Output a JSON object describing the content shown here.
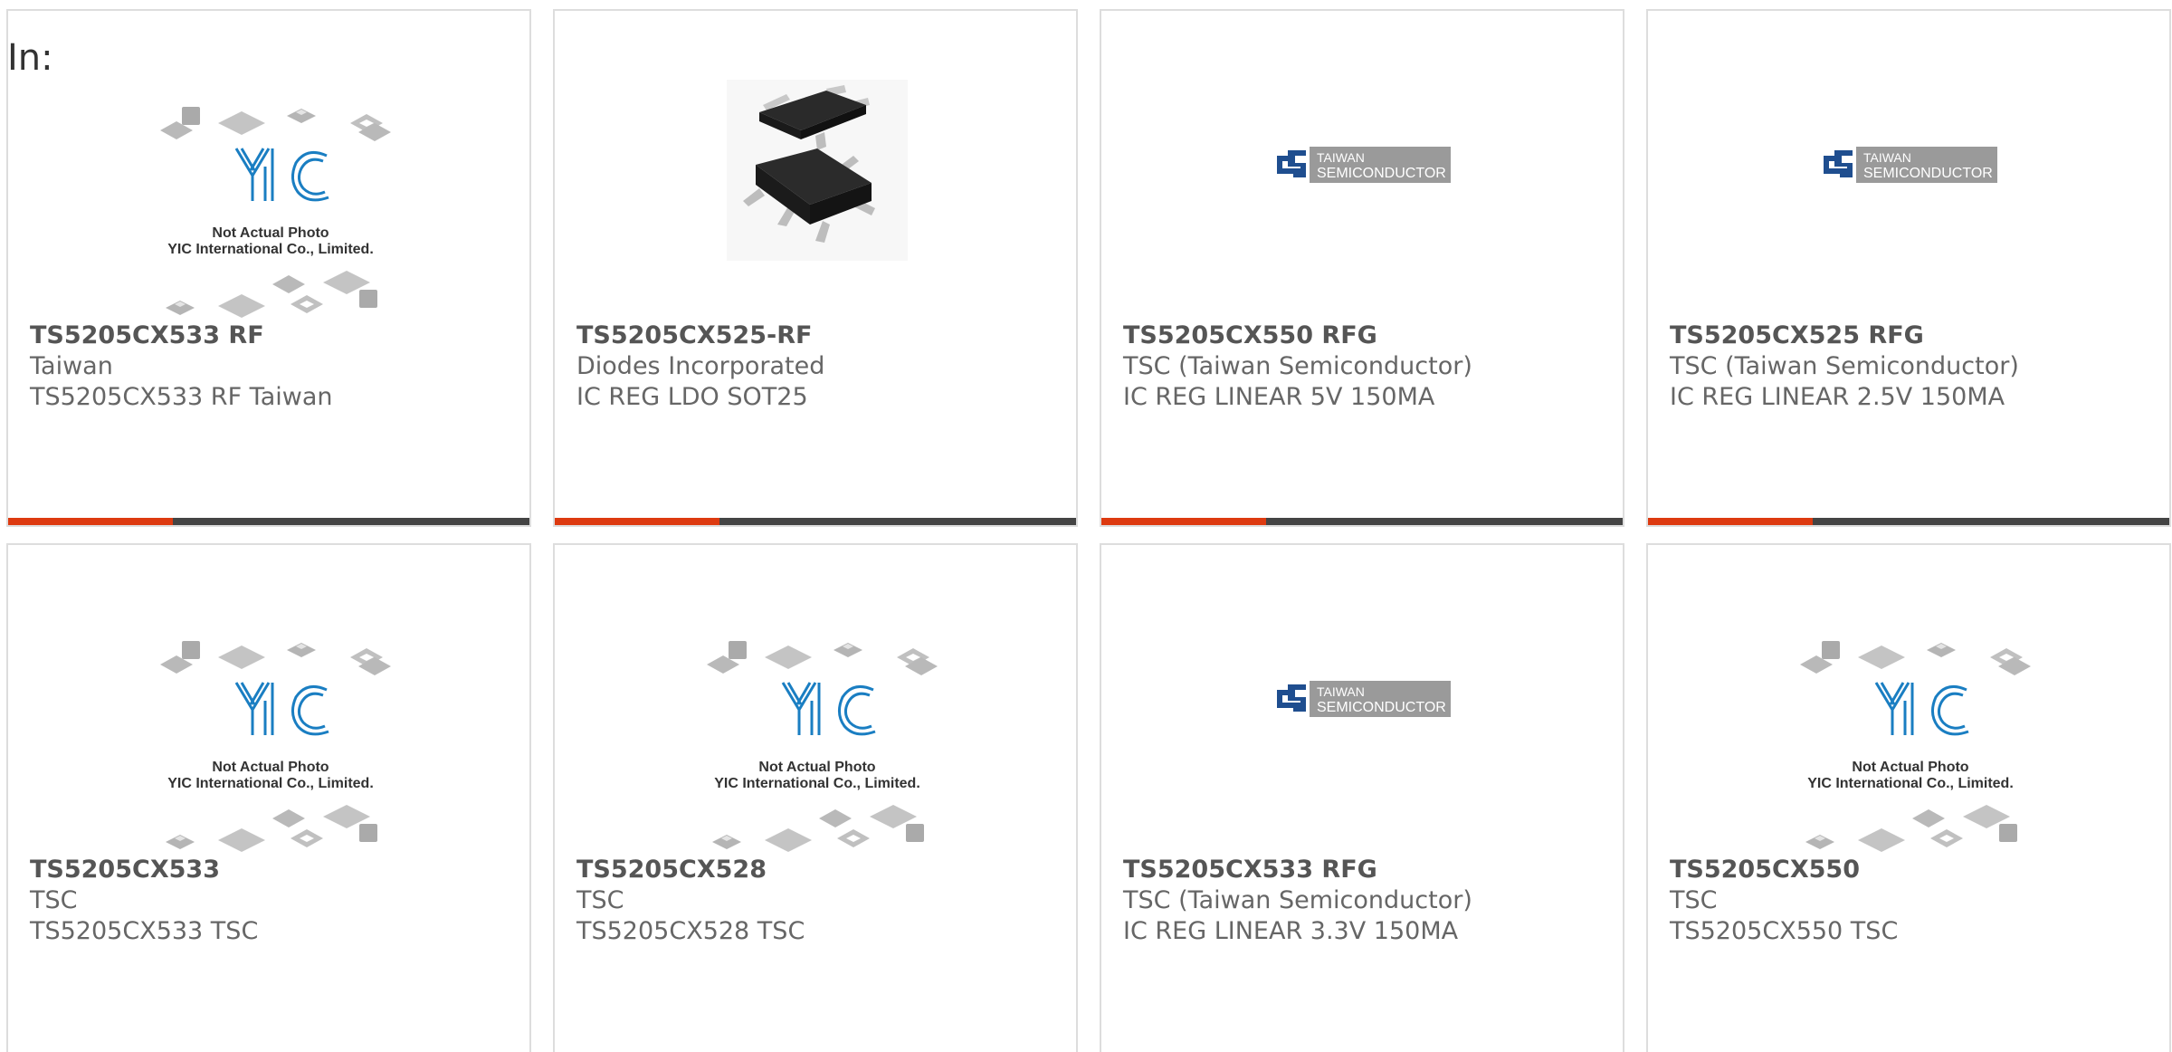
{
  "filter_label": "In:",
  "accent_color": "#dd3a10",
  "bar_color": "#444444",
  "products": [
    {
      "part": "TS5205CX533 RF",
      "maker": "Taiwan",
      "desc": "TS5205CX533 RF Taiwan",
      "image": "yic-placeholder",
      "image_caption_1": "Not Actual Photo",
      "image_caption_2": "YIC International Co., Limited."
    },
    {
      "part": "TS5205CX525-RF",
      "maker": "Diodes Incorporated",
      "desc": "IC REG LDO SOT25",
      "image": "sot25-chip"
    },
    {
      "part": "TS5205CX550 RFG",
      "maker": "TSC (Taiwan Semiconductor)",
      "desc": "IC REG LINEAR 5V 150MA",
      "image": "taiwan-semiconductor-logo",
      "logo_text_1": "TAIWAN",
      "logo_text_2": "SEMICONDUCTOR"
    },
    {
      "part": "TS5205CX525 RFG",
      "maker": "TSC (Taiwan Semiconductor)",
      "desc": "IC REG LINEAR 2.5V 150MA",
      "image": "taiwan-semiconductor-logo",
      "logo_text_1": "TAIWAN",
      "logo_text_2": "SEMICONDUCTOR"
    },
    {
      "part": "TS5205CX533",
      "maker": "TSC",
      "desc": "TS5205CX533 TSC",
      "image": "yic-placeholder",
      "image_caption_1": "Not Actual Photo",
      "image_caption_2": "YIC International Co., Limited."
    },
    {
      "part": "TS5205CX528",
      "maker": "TSC",
      "desc": "TS5205CX528 TSC",
      "image": "yic-placeholder",
      "image_caption_1": "Not Actual Photo",
      "image_caption_2": "YIC International Co., Limited."
    },
    {
      "part": "TS5205CX533 RFG",
      "maker": "TSC (Taiwan Semiconductor)",
      "desc": "IC REG LINEAR 3.3V 150MA",
      "image": "taiwan-semiconductor-logo",
      "logo_text_1": "TAIWAN",
      "logo_text_2": "SEMICONDUCTOR"
    },
    {
      "part": "TS5205CX550",
      "maker": "TSC",
      "desc": "TS5205CX550 TSC",
      "image": "yic-placeholder",
      "image_caption_1": "Not Actual Photo",
      "image_caption_2": "YIC International Co., Limited."
    }
  ]
}
